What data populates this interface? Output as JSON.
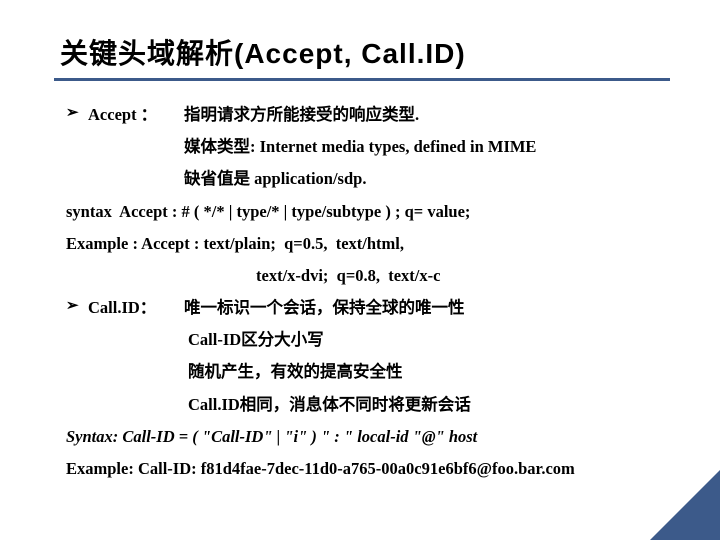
{
  "title": "关键头域解析(Accept, Call.ID)",
  "accept": {
    "bullet": "➢",
    "label": "Accept ：",
    "line1": "指明请求方所能接受的响应类型.",
    "line2": "媒体类型: Internet media types, defined in MIME",
    "line3": "缺省值是 application/sdp."
  },
  "syntax1": "syntax  Accept : # ( */* | type/* | type/subtype ) ; q= value;",
  "example1a": "Example : Accept : text/plain;  q=0.5,  text/html,",
  "example1b": "text/x-dvi;  q=0.8,  text/x-c",
  "callid": {
    "bullet": "➢",
    "label": "Call.ID：",
    "line1": "唯一标识一个会话，保持全球的唯一性",
    "line2": "Call-ID区分大小写",
    "line3": "随机产生，有效的提高安全性",
    "line4": "Call.ID相同，消息体不同时将更新会话"
  },
  "syntax2": "Syntax: Call-ID = ( \"Call-ID\" | \"i\" ) \" : \" local-id \"@\" host",
  "example2": "Example: Call-ID: f81d4fae-7dec-11d0-a765-00a0c91e6bf6@foo.bar.com"
}
